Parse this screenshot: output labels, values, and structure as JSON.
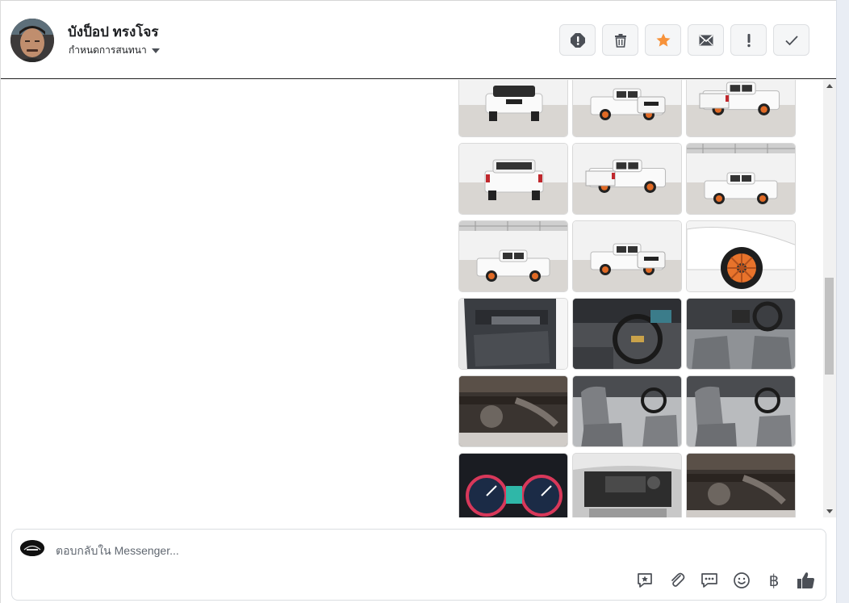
{
  "header": {
    "contact_name": "บังป็อป ทรงโจร",
    "conversation_settings_label": "กำหนดการสนทนา",
    "actions": [
      {
        "name": "report-spam-button",
        "icon": "alert-circle-icon"
      },
      {
        "name": "delete-button",
        "icon": "trash-icon"
      },
      {
        "name": "star-button",
        "icon": "star-icon"
      },
      {
        "name": "mark-unread-button",
        "icon": "envelope-icon"
      },
      {
        "name": "mark-important-button",
        "icon": "exclamation-icon"
      },
      {
        "name": "mark-done-button",
        "icon": "check-icon"
      }
    ]
  },
  "colors": {
    "star": "#f7923a",
    "icon": "#4b4f56",
    "button_bg": "#f5f6f7"
  },
  "gallery": {
    "columns": 3,
    "photos": [
      {
        "label": "front-view",
        "kind": "front"
      },
      {
        "label": "front-angle-left",
        "kind": "front-angle"
      },
      {
        "label": "rear-angle",
        "kind": "rear-angle"
      },
      {
        "label": "rear-view",
        "kind": "rear"
      },
      {
        "label": "rear-angle-left",
        "kind": "rear-angle"
      },
      {
        "label": "side-view-far",
        "kind": "side"
      },
      {
        "label": "side-view-left",
        "kind": "side"
      },
      {
        "label": "front-angle-right",
        "kind": "front-angle"
      },
      {
        "label": "wheel-closeup",
        "kind": "wheel"
      },
      {
        "label": "door-panel",
        "kind": "door"
      },
      {
        "label": "dashboard-steering",
        "kind": "dashboard"
      },
      {
        "label": "rear-cabin",
        "kind": "cabin"
      },
      {
        "label": "undercarriage",
        "kind": "under"
      },
      {
        "label": "front-seats",
        "kind": "seats"
      },
      {
        "label": "rear-seats",
        "kind": "seats"
      },
      {
        "label": "instrument-cluster",
        "kind": "gauges"
      },
      {
        "label": "engine-bay",
        "kind": "engine"
      },
      {
        "label": "underbody-rear",
        "kind": "under"
      }
    ]
  },
  "composer": {
    "placeholder": "ตอบกลับใน Messenger...",
    "tools": [
      {
        "name": "saved-reply-button",
        "icon": "star-bubble-icon"
      },
      {
        "name": "attach-button",
        "icon": "paperclip-icon"
      },
      {
        "name": "quick-reply-button",
        "icon": "chat-dots-icon"
      },
      {
        "name": "emoji-button",
        "icon": "smiley-icon"
      },
      {
        "name": "payment-button",
        "icon": "baht-icon",
        "glyph": "฿"
      },
      {
        "name": "like-button",
        "icon": "thumbs-up-icon"
      }
    ]
  }
}
